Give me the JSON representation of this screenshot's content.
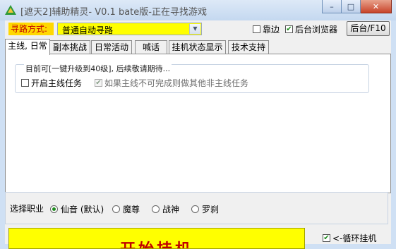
{
  "window": {
    "title": "[遮天2]辅助精灵- V0.1 bate版-正在寻找游戏",
    "minimize_glyph": "–",
    "maximize_glyph": "□",
    "close_glyph": "✕"
  },
  "toolbar": {
    "route_label": "寻路方式:",
    "route_value": "普通自动寻路",
    "dock_label": "靠边",
    "dock_checked": false,
    "bg_browser_label": "后台浏览器",
    "bg_browser_checked": true,
    "bg_button": "后台/F10"
  },
  "tabs": [
    {
      "label": "主线, 日常",
      "active": true
    },
    {
      "label": "副本挑战",
      "active": false
    },
    {
      "label": "日常活动",
      "active": false
    },
    {
      "label": "喊话",
      "active": false
    },
    {
      "label": "挂机状态显示",
      "active": false
    },
    {
      "label": "技术支持",
      "active": false
    }
  ],
  "main_panel": {
    "note": "目前可[一键升级到40级], 后续敬请期待...",
    "open_main_label": "开启主线任务",
    "open_main_checked": false,
    "fallback_label": "如果主线不可完成则做其他非主线任务",
    "fallback_checked": true
  },
  "job": {
    "label": "选择职业",
    "options": [
      "仙音 (默认)",
      "魔尊",
      "战神",
      "罗刹"
    ],
    "selected": 0
  },
  "start_button": "开始挂机",
  "loop_label": "<-循环挂机",
  "loop_checked": true,
  "colors": {
    "accent_yellow": "#ffff00",
    "label_red": "#c00000",
    "check_green": "#1a8a1a"
  }
}
